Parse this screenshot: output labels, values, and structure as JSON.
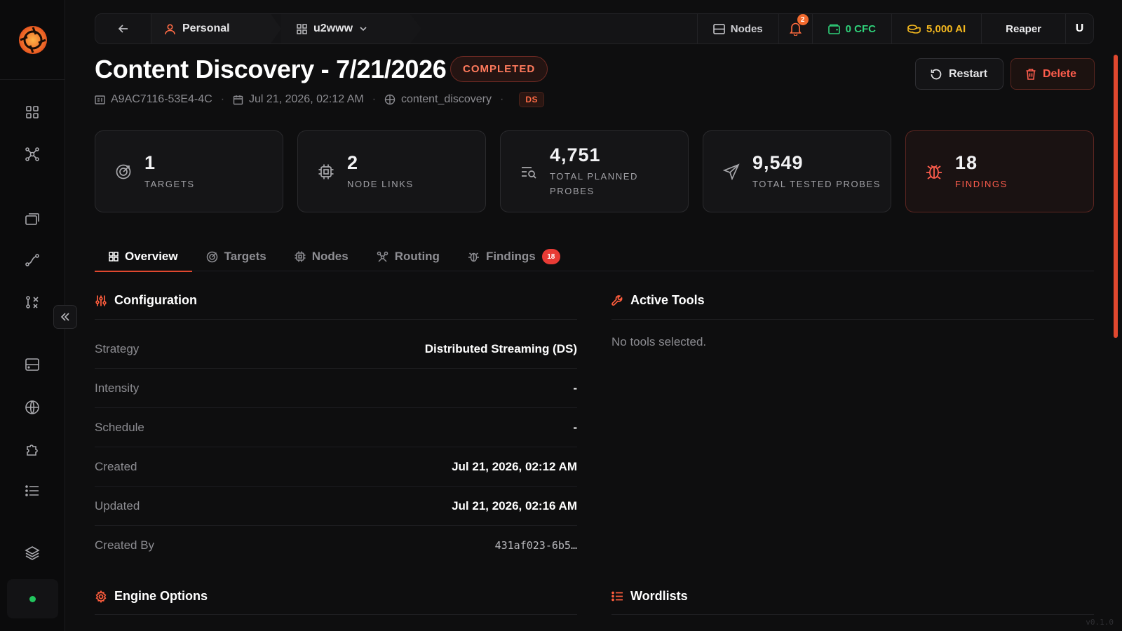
{
  "topbar": {
    "personal_label": "Personal",
    "project_label": "u2www",
    "nodes_label": "Nodes",
    "notification_count": "2",
    "cfc_label": "0 CFC",
    "ai_label": "5,000 AI",
    "user_name": "Reaper",
    "user_initial": "U"
  },
  "header": {
    "title": "Content Discovery - 7/21/2026",
    "status": "COMPLETED",
    "id": "A9AC7116-53E4-4C",
    "date": "Jul 21, 2026, 02:12 AM",
    "type": "content_discovery",
    "strategy_badge": "DS",
    "restart_label": "Restart",
    "delete_label": "Delete"
  },
  "stats": [
    {
      "value": "1",
      "label": "TARGETS"
    },
    {
      "value": "2",
      "label": "NODE LINKS"
    },
    {
      "value": "4,751",
      "label": "TOTAL PLANNED PROBES"
    },
    {
      "value": "9,549",
      "label": "TOTAL TESTED PROBES"
    },
    {
      "value": "18",
      "label": "FINDINGS"
    }
  ],
  "tabs": [
    {
      "label": "Overview"
    },
    {
      "label": "Targets"
    },
    {
      "label": "Nodes"
    },
    {
      "label": "Routing"
    },
    {
      "label": "Findings",
      "badge": "18"
    }
  ],
  "configuration": {
    "title": "Configuration",
    "rows": [
      {
        "key": "Strategy",
        "value": "Distributed Streaming (DS)"
      },
      {
        "key": "Intensity",
        "value": "-"
      },
      {
        "key": "Schedule",
        "value": "-"
      },
      {
        "key": "Created",
        "value": "Jul 21, 2026, 02:12 AM"
      },
      {
        "key": "Updated",
        "value": "Jul 21, 2026, 02:16 AM"
      },
      {
        "key": "Created By",
        "value": "431af023-6b5…"
      }
    ]
  },
  "active_tools": {
    "title": "Active Tools",
    "empty_text": "No tools selected."
  },
  "engine_options": {
    "title": "Engine Options"
  },
  "wordlists": {
    "title": "Wordlists"
  },
  "version": "v0.1.0",
  "colors": {
    "accent": "#e0482f",
    "success": "#22c55e",
    "cfc": "#2fd27a",
    "ai": "#f4b81f"
  }
}
